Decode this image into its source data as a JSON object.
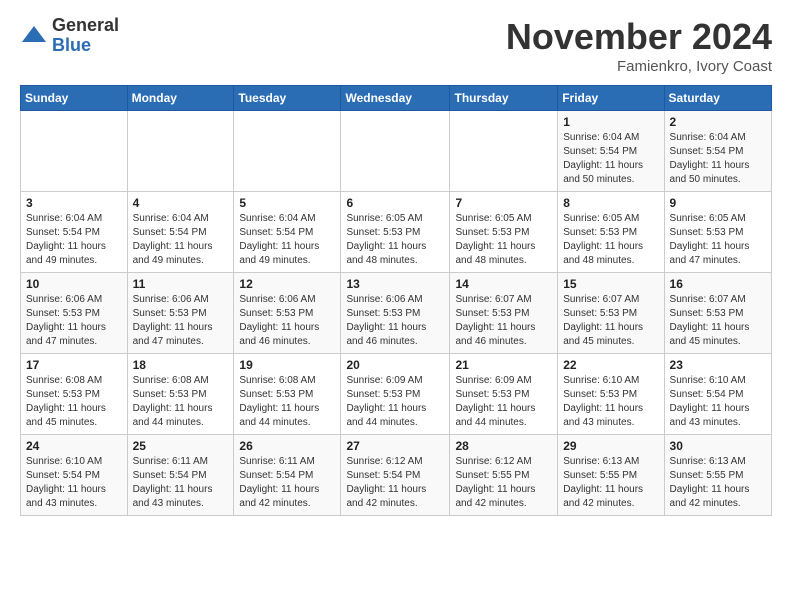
{
  "logo": {
    "general": "General",
    "blue": "Blue"
  },
  "header": {
    "month": "November 2024",
    "location": "Famienkro, Ivory Coast"
  },
  "weekdays": [
    "Sunday",
    "Monday",
    "Tuesday",
    "Wednesday",
    "Thursday",
    "Friday",
    "Saturday"
  ],
  "weeks": [
    [
      {
        "day": "",
        "info": ""
      },
      {
        "day": "",
        "info": ""
      },
      {
        "day": "",
        "info": ""
      },
      {
        "day": "",
        "info": ""
      },
      {
        "day": "",
        "info": ""
      },
      {
        "day": "1",
        "info": "Sunrise: 6:04 AM\nSunset: 5:54 PM\nDaylight: 11 hours\nand 50 minutes."
      },
      {
        "day": "2",
        "info": "Sunrise: 6:04 AM\nSunset: 5:54 PM\nDaylight: 11 hours\nand 50 minutes."
      }
    ],
    [
      {
        "day": "3",
        "info": "Sunrise: 6:04 AM\nSunset: 5:54 PM\nDaylight: 11 hours\nand 49 minutes."
      },
      {
        "day": "4",
        "info": "Sunrise: 6:04 AM\nSunset: 5:54 PM\nDaylight: 11 hours\nand 49 minutes."
      },
      {
        "day": "5",
        "info": "Sunrise: 6:04 AM\nSunset: 5:54 PM\nDaylight: 11 hours\nand 49 minutes."
      },
      {
        "day": "6",
        "info": "Sunrise: 6:05 AM\nSunset: 5:53 PM\nDaylight: 11 hours\nand 48 minutes."
      },
      {
        "day": "7",
        "info": "Sunrise: 6:05 AM\nSunset: 5:53 PM\nDaylight: 11 hours\nand 48 minutes."
      },
      {
        "day": "8",
        "info": "Sunrise: 6:05 AM\nSunset: 5:53 PM\nDaylight: 11 hours\nand 48 minutes."
      },
      {
        "day": "9",
        "info": "Sunrise: 6:05 AM\nSunset: 5:53 PM\nDaylight: 11 hours\nand 47 minutes."
      }
    ],
    [
      {
        "day": "10",
        "info": "Sunrise: 6:06 AM\nSunset: 5:53 PM\nDaylight: 11 hours\nand 47 minutes."
      },
      {
        "day": "11",
        "info": "Sunrise: 6:06 AM\nSunset: 5:53 PM\nDaylight: 11 hours\nand 47 minutes."
      },
      {
        "day": "12",
        "info": "Sunrise: 6:06 AM\nSunset: 5:53 PM\nDaylight: 11 hours\nand 46 minutes."
      },
      {
        "day": "13",
        "info": "Sunrise: 6:06 AM\nSunset: 5:53 PM\nDaylight: 11 hours\nand 46 minutes."
      },
      {
        "day": "14",
        "info": "Sunrise: 6:07 AM\nSunset: 5:53 PM\nDaylight: 11 hours\nand 46 minutes."
      },
      {
        "day": "15",
        "info": "Sunrise: 6:07 AM\nSunset: 5:53 PM\nDaylight: 11 hours\nand 45 minutes."
      },
      {
        "day": "16",
        "info": "Sunrise: 6:07 AM\nSunset: 5:53 PM\nDaylight: 11 hours\nand 45 minutes."
      }
    ],
    [
      {
        "day": "17",
        "info": "Sunrise: 6:08 AM\nSunset: 5:53 PM\nDaylight: 11 hours\nand 45 minutes."
      },
      {
        "day": "18",
        "info": "Sunrise: 6:08 AM\nSunset: 5:53 PM\nDaylight: 11 hours\nand 44 minutes."
      },
      {
        "day": "19",
        "info": "Sunrise: 6:08 AM\nSunset: 5:53 PM\nDaylight: 11 hours\nand 44 minutes."
      },
      {
        "day": "20",
        "info": "Sunrise: 6:09 AM\nSunset: 5:53 PM\nDaylight: 11 hours\nand 44 minutes."
      },
      {
        "day": "21",
        "info": "Sunrise: 6:09 AM\nSunset: 5:53 PM\nDaylight: 11 hours\nand 44 minutes."
      },
      {
        "day": "22",
        "info": "Sunrise: 6:10 AM\nSunset: 5:53 PM\nDaylight: 11 hours\nand 43 minutes."
      },
      {
        "day": "23",
        "info": "Sunrise: 6:10 AM\nSunset: 5:54 PM\nDaylight: 11 hours\nand 43 minutes."
      }
    ],
    [
      {
        "day": "24",
        "info": "Sunrise: 6:10 AM\nSunset: 5:54 PM\nDaylight: 11 hours\nand 43 minutes."
      },
      {
        "day": "25",
        "info": "Sunrise: 6:11 AM\nSunset: 5:54 PM\nDaylight: 11 hours\nand 43 minutes."
      },
      {
        "day": "26",
        "info": "Sunrise: 6:11 AM\nSunset: 5:54 PM\nDaylight: 11 hours\nand 42 minutes."
      },
      {
        "day": "27",
        "info": "Sunrise: 6:12 AM\nSunset: 5:54 PM\nDaylight: 11 hours\nand 42 minutes."
      },
      {
        "day": "28",
        "info": "Sunrise: 6:12 AM\nSunset: 5:55 PM\nDaylight: 11 hours\nand 42 minutes."
      },
      {
        "day": "29",
        "info": "Sunrise: 6:13 AM\nSunset: 5:55 PM\nDaylight: 11 hours\nand 42 minutes."
      },
      {
        "day": "30",
        "info": "Sunrise: 6:13 AM\nSunset: 5:55 PM\nDaylight: 11 hours\nand 42 minutes."
      }
    ]
  ]
}
